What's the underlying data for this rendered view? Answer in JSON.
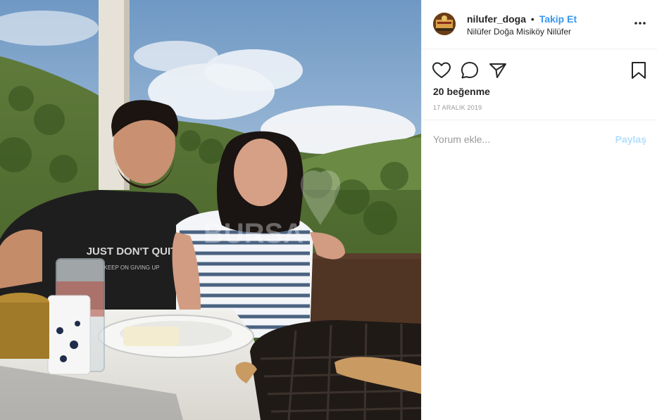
{
  "post": {
    "username": "nilufer_doga",
    "separator": "•",
    "follow_label": "Takip Et",
    "location": "Nilüfer Doğa Misiköy Nilüfer",
    "likes_text": "20 beğenme",
    "date": "17 ARALIK 2019",
    "comment_placeholder": "Yorum ekle...",
    "share_label": "Paylaş"
  },
  "photo": {
    "shirt_text": "JUST DON'T QUIT",
    "shirt_subtext": "KEEP ON GIVING UP",
    "watermark": "BURSA"
  },
  "icons": {
    "more": "more-options-icon",
    "like": "heart-icon",
    "comment": "comment-icon",
    "share": "paper-plane-icon",
    "save": "bookmark-icon"
  },
  "colors": {
    "link_blue": "#3897f0",
    "share_disabled": "#b2dffc",
    "muted_text": "#999999",
    "divider": "#efefef"
  }
}
